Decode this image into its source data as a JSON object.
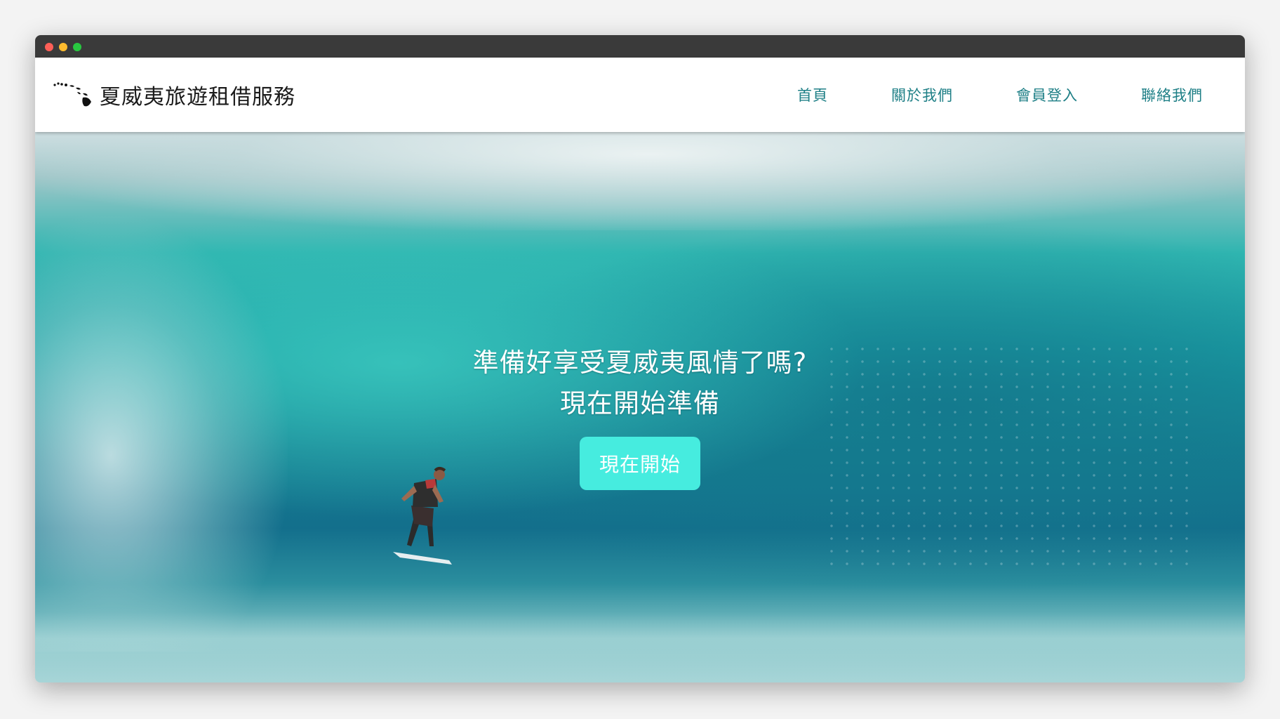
{
  "brand": {
    "logo_icon": "hawaii-islands-icon",
    "name": "夏威夷旅遊租借服務"
  },
  "nav": {
    "items": [
      {
        "label": "首頁"
      },
      {
        "label": "關於我們"
      },
      {
        "label": "會員登入"
      },
      {
        "label": "聯絡我們"
      }
    ]
  },
  "hero": {
    "headline_line1": "準備好享受夏威夷風情了嗎?",
    "headline_line2": "現在開始準備",
    "cta_label": "現在開始",
    "background": "surfer-wave-photo"
  },
  "colors": {
    "nav_link": "#1e7f86",
    "cta_bg": "#46ecdf",
    "titlebar": "#3a3a3a"
  }
}
